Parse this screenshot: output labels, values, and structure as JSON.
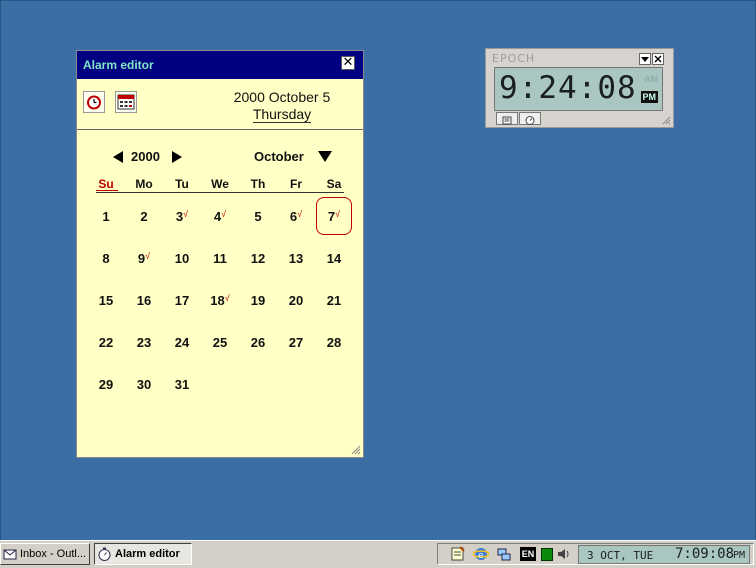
{
  "alarm_editor": {
    "title": "Alarm editor",
    "date_line": "2000 October 5",
    "weekday": "Thursday",
    "year": "2000",
    "month": "October",
    "weekdays": [
      "Su",
      "Mo",
      "Tu",
      "We",
      "Th",
      "Fr",
      "Sa"
    ],
    "days": [
      {
        "label": "1"
      },
      {
        "label": "2"
      },
      {
        "label": "3",
        "check": "√"
      },
      {
        "label": "4",
        "check": "√"
      },
      {
        "label": "5"
      },
      {
        "label": "6",
        "check": "√"
      },
      {
        "label": "7",
        "check": "√",
        "today": true
      },
      {
        "label": "8"
      },
      {
        "label": "9",
        "check": "√"
      },
      {
        "label": "10"
      },
      {
        "label": "11"
      },
      {
        "label": "12"
      },
      {
        "label": "13"
      },
      {
        "label": "14"
      },
      {
        "label": "15"
      },
      {
        "label": "16"
      },
      {
        "label": "17"
      },
      {
        "label": "18",
        "check": "√"
      },
      {
        "label": "19"
      },
      {
        "label": "20"
      },
      {
        "label": "21"
      },
      {
        "label": "22"
      },
      {
        "label": "23"
      },
      {
        "label": "24"
      },
      {
        "label": "25"
      },
      {
        "label": "26"
      },
      {
        "label": "27"
      },
      {
        "label": "28"
      },
      {
        "label": "29"
      },
      {
        "label": "30"
      },
      {
        "label": "31"
      }
    ],
    "close_glyph": "✕"
  },
  "epoch_clock": {
    "title": "EPOCH",
    "time": "9:24:08",
    "ghost_label": "AM",
    "ampm": "PM"
  },
  "taskbar": {
    "tasks": [
      {
        "label": "Inbox - Outl..."
      },
      {
        "label": "Alarm editor"
      }
    ],
    "tray": {
      "lang": "EN",
      "date": "3 OCT, TUE",
      "time": "7:09:08",
      "ampm": "PM"
    }
  },
  "colors": {
    "desktop": "#3a6ea5",
    "title_bar": "#000080",
    "calendar_bg": "#ffffc6",
    "accent_red": "#c00000",
    "lcd": "#a9c6c0"
  },
  "icons": {
    "alarm_clock": "alarm-clock-icon",
    "calendar": "calendar-icon",
    "close": "close-icon"
  }
}
